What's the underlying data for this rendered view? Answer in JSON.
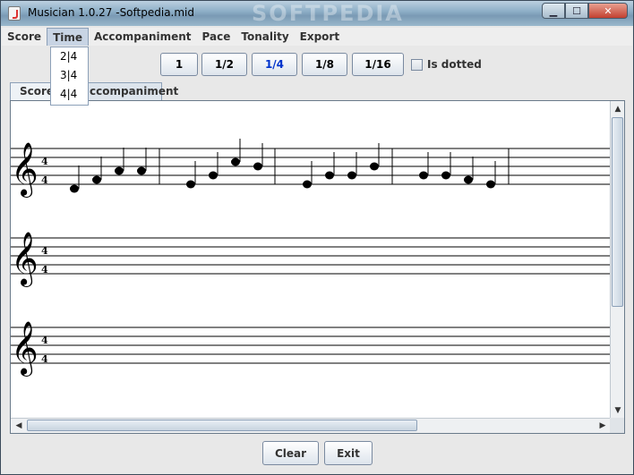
{
  "window": {
    "title": "Musician 1.0.27 -Softpedia.mid",
    "watermark": "SOFTPEDIA"
  },
  "menu": {
    "items": [
      "Score",
      "Time",
      "Accompaniment",
      "Pace",
      "Tonality",
      "Export"
    ],
    "active": "Time",
    "dropdown": [
      "2|4",
      "3|4",
      "4|4"
    ]
  },
  "toolbar": {
    "durations": [
      "1",
      "1/2",
      "1/4",
      "1/8",
      "1/16"
    ],
    "selected": "1/4",
    "dotted_label": "Is dotted"
  },
  "tabs": [
    "Score",
    "ccompaniment"
  ],
  "score": {
    "time_signature_top": "4",
    "time_signature_bottom": "4",
    "staff_count": 3
  },
  "buttons": {
    "clear": "Clear",
    "exit": "Exit"
  }
}
